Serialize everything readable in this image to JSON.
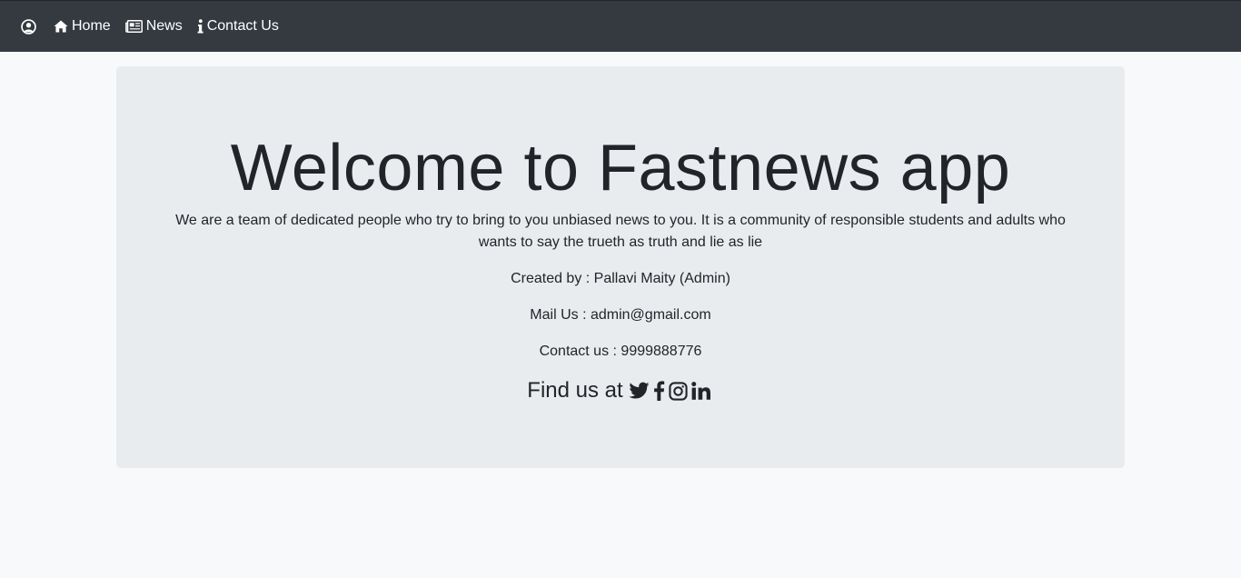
{
  "nav": {
    "items": [
      {
        "icon": "user-circle-icon",
        "label": ""
      },
      {
        "icon": "home-icon",
        "label": "Home"
      },
      {
        "icon": "newspaper-icon",
        "label": "News"
      },
      {
        "icon": "info-icon",
        "label": "Contact Us"
      }
    ]
  },
  "jumbotron": {
    "title": "Welcome to Fastnews app",
    "description": "We are a team of dedicated people who try to bring to you unbiased news to you. It is a community of responsible students and adults who wants to say the trueth as truth and lie as lie",
    "created_by": "Created by : Pallavi Maity (Admin)",
    "mail": "Mail Us : admin@gmail.com",
    "contact": "Contact us : 9999888776",
    "find_us": "Find us at",
    "social": [
      {
        "icon": "twitter-icon"
      },
      {
        "icon": "facebook-icon"
      },
      {
        "icon": "instagram-icon"
      },
      {
        "icon": "linkedin-icon"
      }
    ]
  },
  "colors": {
    "navbar": "#343a40",
    "page_background": "#f8f9fa",
    "jumbotron_background": "#e9ecef",
    "text": "#212529"
  }
}
